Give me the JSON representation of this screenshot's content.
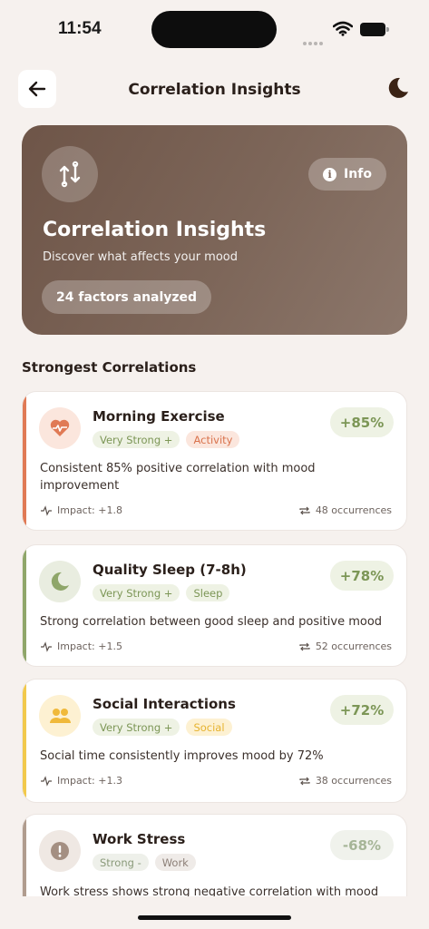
{
  "status": {
    "time": "11:54"
  },
  "header": {
    "title": "Correlation Insights"
  },
  "hero": {
    "title": "Correlation Insights",
    "subtitle": "Discover what affects your mood",
    "info_label": "Info",
    "factors_chip": "24 factors analyzed"
  },
  "section": {
    "title": "Strongest Correlations"
  },
  "cards": [
    {
      "title": "Morning Exercise",
      "strength": "Very Strong +",
      "category": "Activity",
      "percent": "+85%",
      "description": "Consistent 85% positive correlation with mood improvement",
      "impact": "Impact: +1.8",
      "occurrences": "48 occurrences",
      "accent_color": "#e07a55",
      "icon": "heart-pulse-icon"
    },
    {
      "title": "Quality Sleep (7-8h)",
      "strength": "Very Strong +",
      "category": "Sleep",
      "percent": "+78%",
      "description": "Strong correlation between good sleep and positive mood",
      "impact": "Impact: +1.5",
      "occurrences": "52 occurrences",
      "accent_color": "#8fa66a",
      "icon": "moon-icon"
    },
    {
      "title": "Social Interactions",
      "strength": "Very Strong +",
      "category": "Social",
      "percent": "+72%",
      "description": "Social time consistently improves mood by 72%",
      "impact": "Impact: +1.3",
      "occurrences": "38 occurrences",
      "accent_color": "#f2c94c",
      "icon": "people-icon"
    },
    {
      "title": "Work Stress",
      "strength": "Strong -",
      "category": "Work",
      "percent": "-68%",
      "description": "Work stress shows strong negative correlation with mood",
      "accent_color": "#b09c8e",
      "icon": "alert-icon"
    }
  ]
}
